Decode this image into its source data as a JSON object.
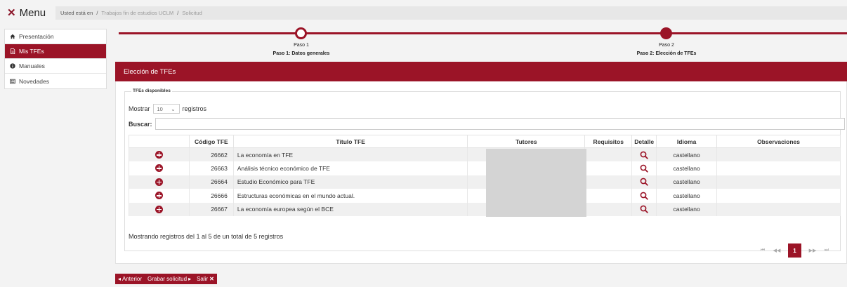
{
  "menu": {
    "label": "Menu"
  },
  "breadcrumb": {
    "lead": "Usted está en",
    "sep1": "/",
    "item1": "Trabajos fin de estudios UCLM",
    "sep2": "/",
    "item2": "Solicitud"
  },
  "sidebar": {
    "items": [
      {
        "label": "Presentación",
        "icon": "home-icon"
      },
      {
        "label": "Mis TFEs",
        "icon": "document-icon",
        "active": true
      },
      {
        "label": "Manuales",
        "icon": "info-icon"
      },
      {
        "label": "Novedades",
        "icon": "newspaper-icon"
      }
    ]
  },
  "stepper": {
    "step1": {
      "title": "Paso 1",
      "subtitle": "Paso 1: Datos generales"
    },
    "step2": {
      "title": "Paso 2",
      "subtitle": "Paso 2: Elección de TFEs"
    }
  },
  "panel": {
    "title": "Elección de TFEs",
    "legend": "TFEs disponibles"
  },
  "controls": {
    "show_label": "Mostrar",
    "page_size": "10",
    "records_label": "registros",
    "search_label": "Buscar:"
  },
  "table": {
    "headers": [
      "",
      "Código TFE",
      "Título TFE",
      "Tutores",
      "Requisitos",
      "Detalle",
      "Idioma",
      "Observaciones"
    ],
    "rows": [
      {
        "code": "26662",
        "title": "La economía en TFE",
        "language": "castellano"
      },
      {
        "code": "26663",
        "title": "Análisis técnico económico de TFE",
        "language": "castellano"
      },
      {
        "code": "26664",
        "title": "Estudio Económico para TFE",
        "language": "castellano"
      },
      {
        "code": "26666",
        "title": "Estructuras económicas en el mundo actual.",
        "language": "castellano"
      },
      {
        "code": "26667",
        "title": "La economía europea según el BCE",
        "language": "castellano"
      }
    ]
  },
  "footer": {
    "info": "Mostrando registros del 1 al 5 de un total de 5 registros"
  },
  "pagination": {
    "current": "1"
  },
  "actions": {
    "previous": "Anterior",
    "save": "Grabar solicitud",
    "exit": "Salir"
  },
  "colors": {
    "accent": "#9b1427"
  }
}
